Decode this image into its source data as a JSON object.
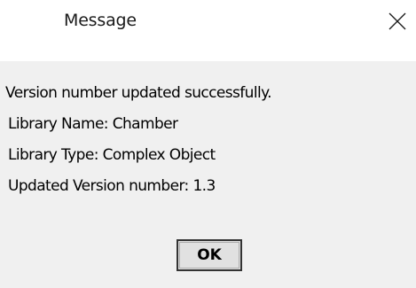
{
  "window": {
    "title": "Message",
    "close_icon": "close-icon"
  },
  "message": {
    "line1": "Version number updated successfully.",
    "line2": "Library Name: Chamber",
    "line3": "Library Type: Complex Object",
    "line4": "Updated Version number: 1.3"
  },
  "buttons": {
    "ok_label": "OK"
  },
  "colors": {
    "title_background": "#ffffff",
    "body_background": "#f0f0f0",
    "button_background": "#e1e1e1",
    "button_border": "#333333"
  }
}
